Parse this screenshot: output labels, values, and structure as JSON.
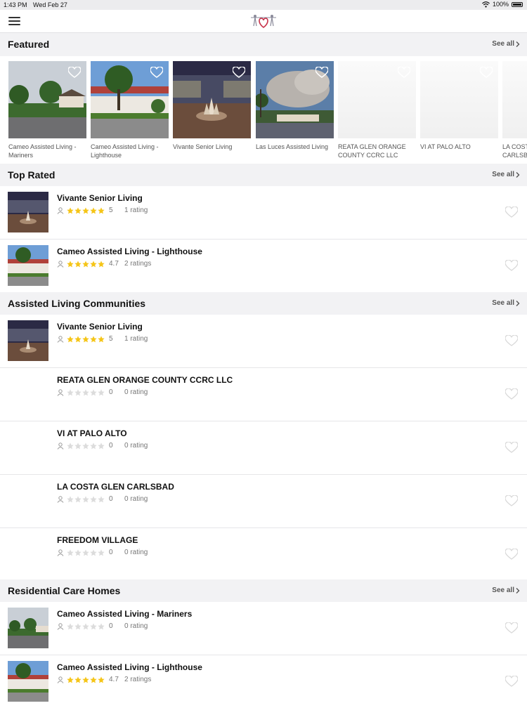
{
  "status_bar": {
    "time": "1:43 PM",
    "date": "Wed Feb 27",
    "battery": "100%"
  },
  "header": {
    "menu_icon": "hamburger-icon",
    "logo": "app-logo-heart"
  },
  "see_all": "See all",
  "featured": {
    "title": "Featured",
    "items": [
      {
        "name": "Cameo Assisted Living - Mariners",
        "image": "photo"
      },
      {
        "name": "Cameo Assisted Living - Lighthouse",
        "image": "photo"
      },
      {
        "name": "Vivante Senior Living",
        "image": "photo"
      },
      {
        "name": "Las Luces Assisted Living",
        "image": "photo"
      },
      {
        "name": "REATA GLEN ORANGE COUNTY CCRC LLC",
        "image": "blank"
      },
      {
        "name": "VI AT PALO ALTO",
        "image": "blank"
      },
      {
        "name": "LA COSTA GLEN CARLSBAD",
        "image": "blank"
      }
    ]
  },
  "top_rated": {
    "title": "Top Rated",
    "items": [
      {
        "name": "Vivante Senior Living",
        "stars": 5,
        "score": "5",
        "ratings": "1 rating"
      },
      {
        "name": "Cameo Assisted Living - Lighthouse",
        "stars": 5,
        "score": "4.7",
        "ratings": "2 ratings"
      }
    ]
  },
  "assisted_living": {
    "title": "Assisted Living Communities",
    "items": [
      {
        "name": "Vivante Senior Living",
        "stars": 5,
        "score": "5",
        "ratings": "1 rating"
      },
      {
        "name": "REATA GLEN ORANGE COUNTY CCRC LLC",
        "stars": 0,
        "score": "0",
        "ratings": "0 rating"
      },
      {
        "name": "VI AT PALO ALTO",
        "stars": 0,
        "score": "0",
        "ratings": "0 rating"
      },
      {
        "name": "LA COSTA GLEN CARLSBAD",
        "stars": 0,
        "score": "0",
        "ratings": "0 rating"
      },
      {
        "name": "FREEDOM VILLAGE",
        "stars": 0,
        "score": "0",
        "ratings": "0 rating"
      }
    ]
  },
  "residential_care": {
    "title": "Residential Care Homes",
    "items": [
      {
        "name": "Cameo Assisted Living - Mariners",
        "stars": 0,
        "score": "0",
        "ratings": "0 rating"
      },
      {
        "name": "Cameo Assisted Living - Lighthouse",
        "stars": 5,
        "score": "4.7",
        "ratings": "2 ratings"
      }
    ]
  },
  "colors": {
    "star_filled": "#f5c518",
    "star_empty": "#dcdcdc",
    "heart_outline": "#d8d8d8",
    "logo_red": "#c8324a"
  }
}
